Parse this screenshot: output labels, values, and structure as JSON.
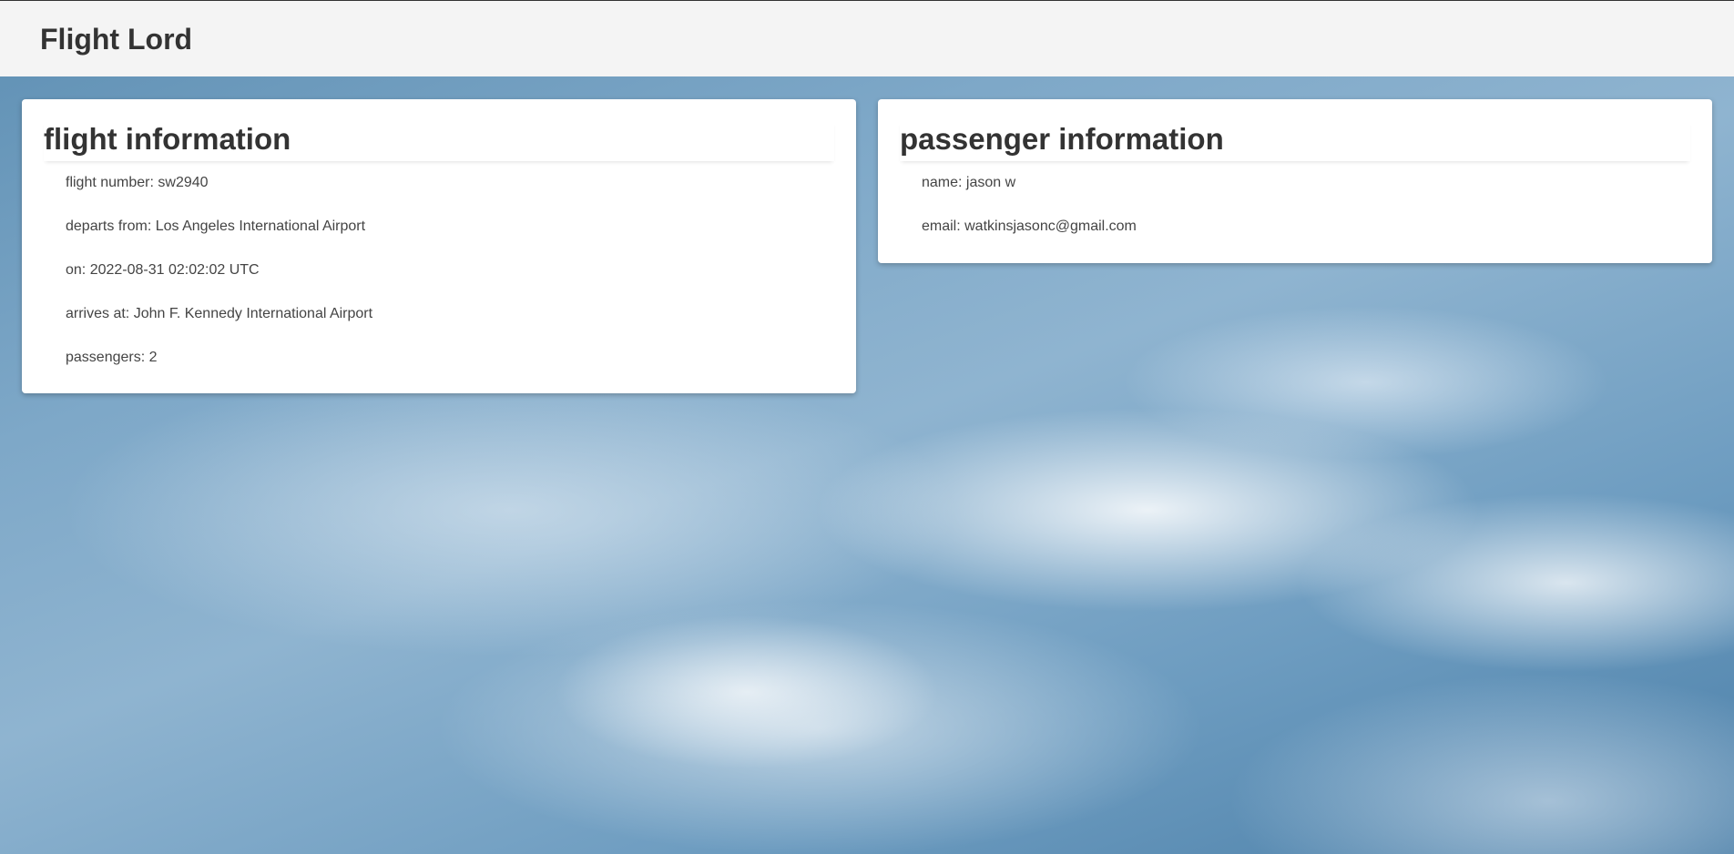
{
  "header": {
    "brand": "Flight Lord"
  },
  "flight": {
    "title": "flight information",
    "fields": [
      "flight number: sw2940",
      "departs from: Los Angeles International Airport",
      "on: 2022-08-31 02:02:02 UTC",
      "arrives at: John F. Kennedy International Airport",
      "passengers: 2"
    ]
  },
  "passenger": {
    "title": "passenger information",
    "fields": [
      "name: jason w",
      "email: watkinsjasonc@gmail.com"
    ]
  }
}
